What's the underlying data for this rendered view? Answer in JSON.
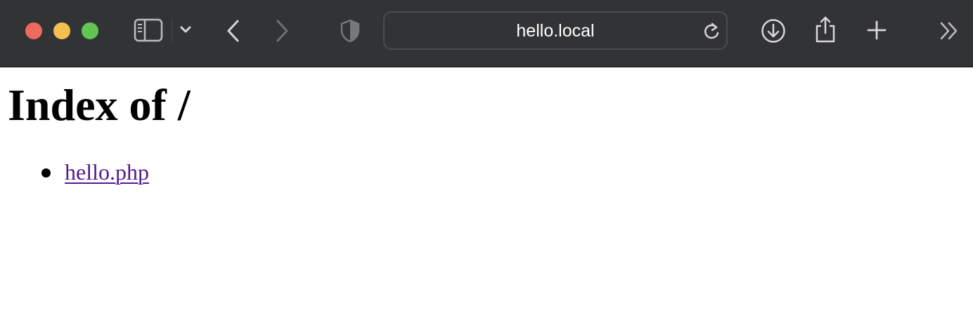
{
  "browser": {
    "address_bar": {
      "url": "hello.local"
    },
    "toolbar_icons": [
      "close-window-button",
      "minimize-window-button",
      "zoom-window-button",
      "sidebar-icon",
      "chevron-down-icon",
      "back-arrow-icon",
      "forward-arrow-icon",
      "privacy-shield-icon",
      "reload-icon",
      "download-icon",
      "share-icon",
      "plus-icon",
      "double-chevron-icon"
    ],
    "colors": {
      "toolbar": "#323335",
      "close": "#ed6a5e",
      "minimize": "#f5bf4f",
      "zoom": "#61c554",
      "visited_link": "#551a8b"
    }
  },
  "page": {
    "heading": "Index of /",
    "entries": [
      {
        "label": "hello.php"
      }
    ]
  }
}
